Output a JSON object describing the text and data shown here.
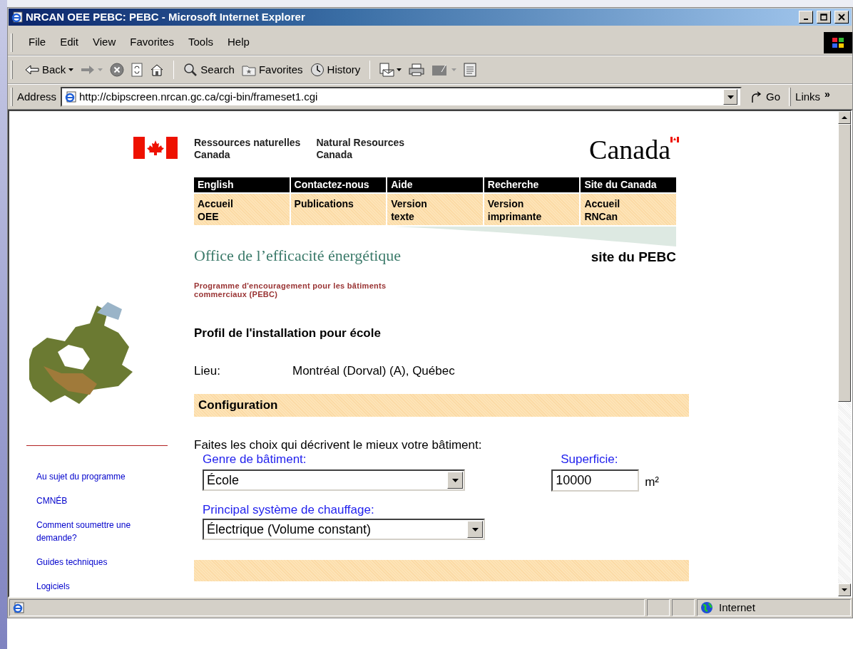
{
  "window": {
    "title": "NRCAN OEE PEBC: PEBC - Microsoft Internet Explorer"
  },
  "menu": [
    "File",
    "Edit",
    "View",
    "Favorites",
    "Tools",
    "Help"
  ],
  "toolbar": [
    {
      "kind": "back",
      "label": "Back"
    },
    {
      "kind": "forward"
    },
    {
      "kind": "stop"
    },
    {
      "kind": "refresh"
    },
    {
      "kind": "home"
    },
    {
      "kind": "search",
      "label": "Search"
    },
    {
      "kind": "favorites",
      "label": "Favorites"
    },
    {
      "kind": "history",
      "label": "History"
    },
    {
      "kind": "mail"
    },
    {
      "kind": "print"
    },
    {
      "kind": "edit"
    },
    {
      "kind": "discuss"
    }
  ],
  "address": {
    "label": "Address",
    "value": "http://cbipscreen.nrcan.gc.ca/cgi-bin/frameset1.cgi",
    "go": "Go",
    "links": "Links",
    "more": "»"
  },
  "header": {
    "dept_fr": [
      "Ressources naturelles",
      "Canada"
    ],
    "dept_en": [
      "Natural Resources",
      "Canada"
    ],
    "wordmark": "Canada"
  },
  "nav_top": [
    "English",
    "Contactez-nous",
    "Aide",
    "Recherche",
    "Site du Canada"
  ],
  "nav_bottom": [
    [
      "Accueil",
      "OEE"
    ],
    [
      "Publications"
    ],
    [
      "Version",
      "texte"
    ],
    [
      "Version",
      "imprimante"
    ],
    [
      "Accueil",
      "RNCan"
    ]
  ],
  "office_title": "Office de l’efficacité énergétique",
  "site_label": "site du PEBC",
  "program": [
    "Programme d'encouragement pour les bâtiments",
    "commerciaux (PEBC)"
  ],
  "sidebar": {
    "links": [
      "Au sujet du programme",
      "CMNÉB",
      "Comment soumettre une demande?",
      "Guides techniques",
      "Logiciels"
    ]
  },
  "page": {
    "heading": "Profil de l'installation pour école",
    "location_label": "Lieu:",
    "location_value": "Montréal (Dorval) (A), Québec",
    "section": "Configuration",
    "intro": "Faites les choix qui décrivent le mieux votre bâtiment:",
    "building_type": {
      "label": "Genre de bâtiment:",
      "value": "École"
    },
    "area": {
      "label": "Superficie:",
      "value": "10000",
      "unit": "m²"
    },
    "heating": {
      "label": "Principal système de chauffage:",
      "value": "Électrique (Volume constant)"
    }
  },
  "status_bar": {
    "zone": "Internet"
  }
}
